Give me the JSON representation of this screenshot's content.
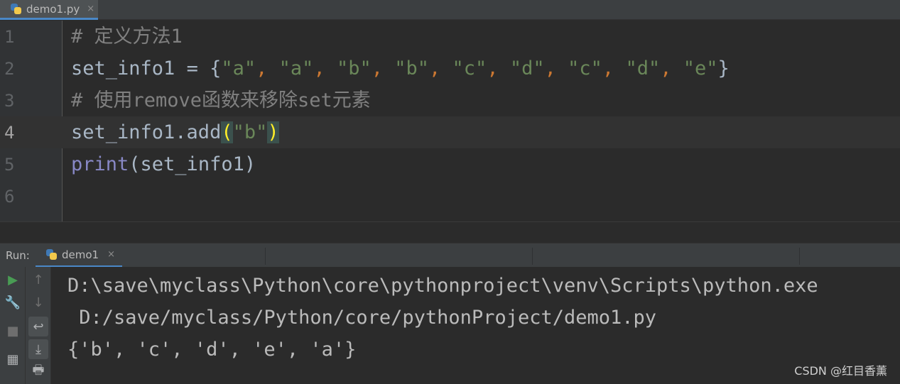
{
  "editor_tab": {
    "filename": "demo1.py",
    "close_glyph": "×"
  },
  "editor": {
    "lines": [
      {
        "number": "1",
        "comment": "# 定义方法1"
      },
      {
        "number": "2",
        "var": "set_info1",
        "eq": " = ",
        "open": "{",
        "items": [
          "\"a\"",
          "\"a\"",
          "\"b\"",
          "\"b\"",
          "\"c\"",
          "\"d\"",
          "\"c\"",
          "\"d\"",
          "\"e\""
        ],
        "comma": ", ",
        "close": "}"
      },
      {
        "number": "3",
        "comment": "# 使用remove函数来移除set元素"
      },
      {
        "number": "4",
        "prefix": "set_info1.add",
        "lparen": "(",
        "arg": "\"b\"",
        "rparen": ")"
      },
      {
        "number": "5",
        "func": "print",
        "rest": "(set_info1)"
      },
      {
        "number": "6"
      }
    ]
  },
  "run_panel": {
    "label": "Run:",
    "tab_name": "demo1",
    "close_glyph": "×",
    "output": [
      "D:\\save\\myclass\\Python\\core\\pythonproject\\venv\\Scripts\\python.exe",
      " D:/save/myclass/Python/core/pythonProject/demo1.py",
      "{'b', 'c', 'd', 'e', 'a'}"
    ],
    "tools_left": [
      "run-icon",
      "wrench-icon",
      "stop-icon",
      "layout-icon"
    ],
    "tools_right": [
      "arrow-up-icon",
      "arrow-down-icon",
      "soft-wrap-icon",
      "scroll-to-end-icon",
      "print-icon"
    ]
  },
  "watermark": "CSDN @红目香薰",
  "colors": {
    "string": "#6a8759",
    "keyword": "#cc7832",
    "comment": "#808080",
    "builtin": "#8888c6",
    "bracket_highlight": "#ffef28"
  }
}
